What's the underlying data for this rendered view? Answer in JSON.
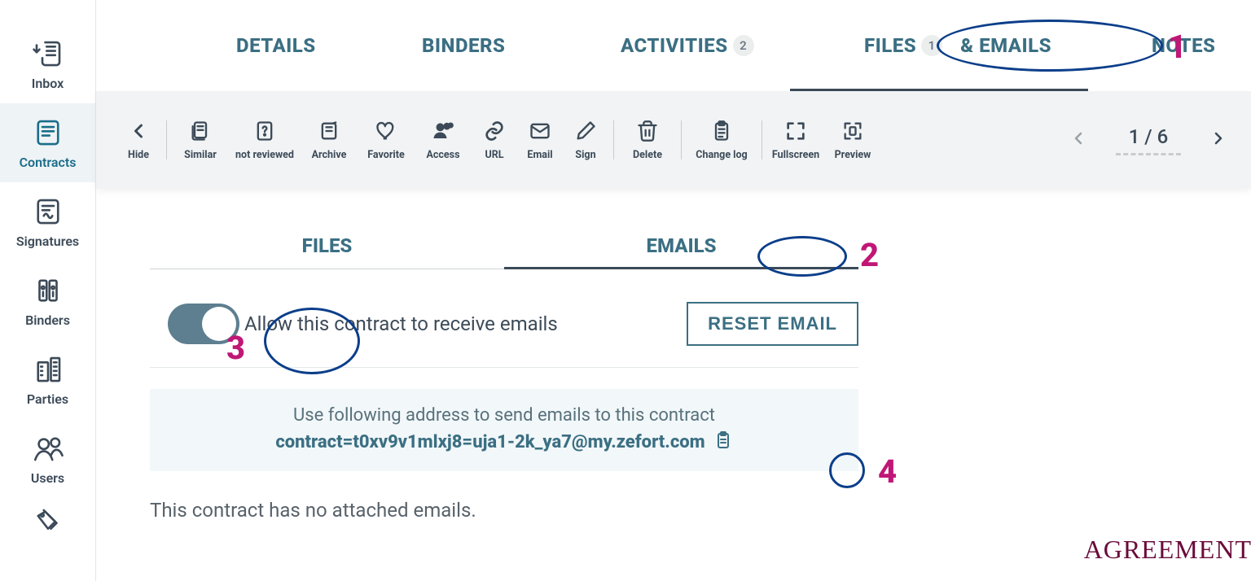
{
  "sidebar": {
    "items": [
      {
        "label": "Inbox"
      },
      {
        "label": "Contracts"
      },
      {
        "label": "Signatures"
      },
      {
        "label": "Binders"
      },
      {
        "label": "Parties"
      },
      {
        "label": "Users"
      }
    ]
  },
  "top_tabs": {
    "details": "DETAILS",
    "binders": "BINDERS",
    "activities": "ACTIVITIES",
    "activities_badge": "2",
    "files_label": "FILES",
    "files_badge": "1",
    "emails_suffix": "& EMAILS",
    "notes": "NOTES"
  },
  "toolbar": {
    "hide": "Hide",
    "similar": "Similar",
    "not_reviewed": "not reviewed",
    "archive": "Archive",
    "favorite": "Favorite",
    "access": "Access",
    "url": "URL",
    "email": "Email",
    "sign": "Sign",
    "delete": "Delete",
    "change_log": "Change log",
    "fullscreen": "Fullscreen",
    "preview": "Preview"
  },
  "pager": {
    "text": "1 / 6"
  },
  "subtabs": {
    "files": "FILES",
    "emails": "EMAILS"
  },
  "emails_panel": {
    "toggle_label": "Allow this contract to receive emails",
    "reset_button": "RESET EMAIL",
    "instruction": "Use following address to send emails to this contract",
    "address": "contract=t0xv9v1mlxj8=uja1-2k_ya7@my.zefort.com",
    "empty": "This contract has no attached emails."
  },
  "footer_word": "AGREEMENT",
  "annotations": {
    "1": "1",
    "2": "2",
    "3": "3",
    "4": "4"
  }
}
